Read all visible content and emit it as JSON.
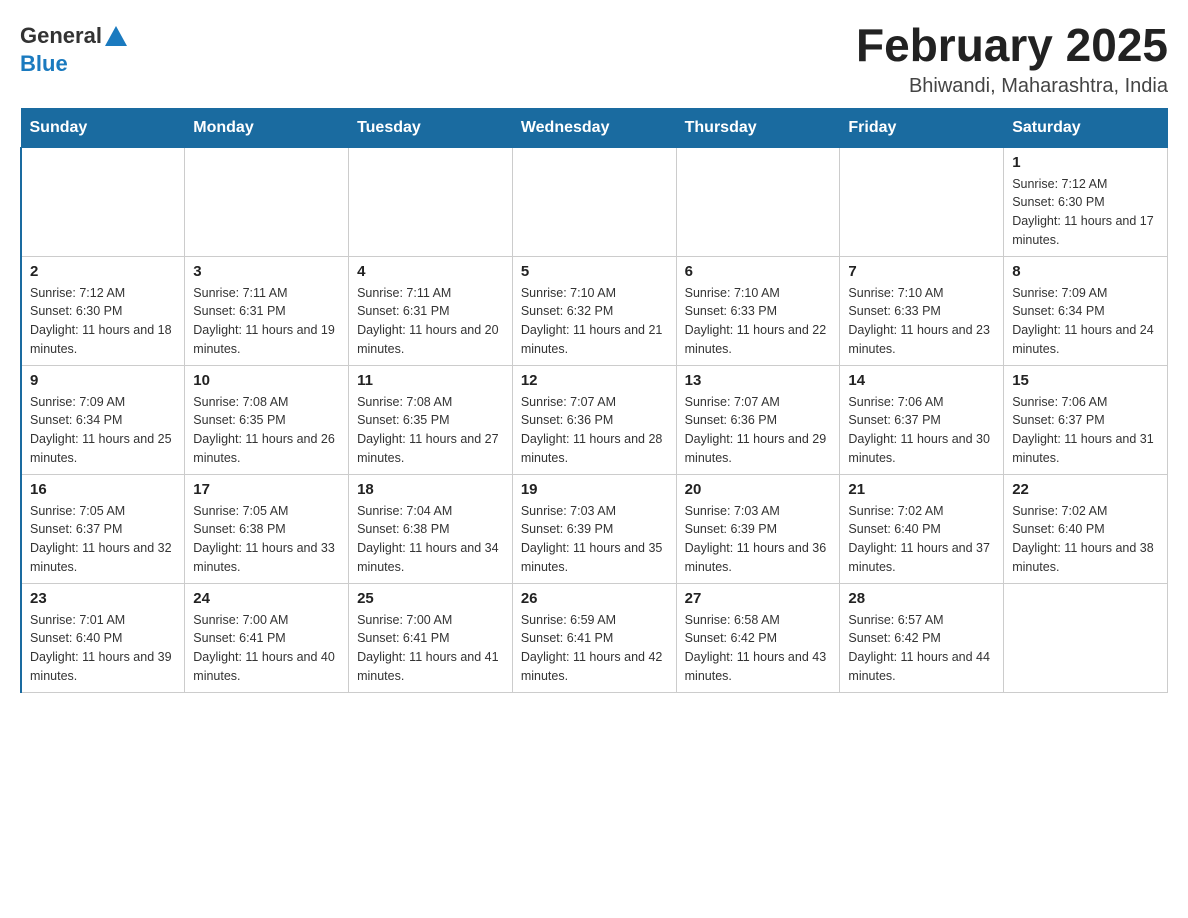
{
  "header": {
    "logo_general": "General",
    "logo_blue": "Blue",
    "title": "February 2025",
    "subtitle": "Bhiwandi, Maharashtra, India"
  },
  "weekdays": [
    "Sunday",
    "Monday",
    "Tuesday",
    "Wednesday",
    "Thursday",
    "Friday",
    "Saturday"
  ],
  "weeks": [
    [
      {
        "day": "",
        "info": ""
      },
      {
        "day": "",
        "info": ""
      },
      {
        "day": "",
        "info": ""
      },
      {
        "day": "",
        "info": ""
      },
      {
        "day": "",
        "info": ""
      },
      {
        "day": "",
        "info": ""
      },
      {
        "day": "1",
        "info": "Sunrise: 7:12 AM\nSunset: 6:30 PM\nDaylight: 11 hours and 17 minutes."
      }
    ],
    [
      {
        "day": "2",
        "info": "Sunrise: 7:12 AM\nSunset: 6:30 PM\nDaylight: 11 hours and 18 minutes."
      },
      {
        "day": "3",
        "info": "Sunrise: 7:11 AM\nSunset: 6:31 PM\nDaylight: 11 hours and 19 minutes."
      },
      {
        "day": "4",
        "info": "Sunrise: 7:11 AM\nSunset: 6:31 PM\nDaylight: 11 hours and 20 minutes."
      },
      {
        "day": "5",
        "info": "Sunrise: 7:10 AM\nSunset: 6:32 PM\nDaylight: 11 hours and 21 minutes."
      },
      {
        "day": "6",
        "info": "Sunrise: 7:10 AM\nSunset: 6:33 PM\nDaylight: 11 hours and 22 minutes."
      },
      {
        "day": "7",
        "info": "Sunrise: 7:10 AM\nSunset: 6:33 PM\nDaylight: 11 hours and 23 minutes."
      },
      {
        "day": "8",
        "info": "Sunrise: 7:09 AM\nSunset: 6:34 PM\nDaylight: 11 hours and 24 minutes."
      }
    ],
    [
      {
        "day": "9",
        "info": "Sunrise: 7:09 AM\nSunset: 6:34 PM\nDaylight: 11 hours and 25 minutes."
      },
      {
        "day": "10",
        "info": "Sunrise: 7:08 AM\nSunset: 6:35 PM\nDaylight: 11 hours and 26 minutes."
      },
      {
        "day": "11",
        "info": "Sunrise: 7:08 AM\nSunset: 6:35 PM\nDaylight: 11 hours and 27 minutes."
      },
      {
        "day": "12",
        "info": "Sunrise: 7:07 AM\nSunset: 6:36 PM\nDaylight: 11 hours and 28 minutes."
      },
      {
        "day": "13",
        "info": "Sunrise: 7:07 AM\nSunset: 6:36 PM\nDaylight: 11 hours and 29 minutes."
      },
      {
        "day": "14",
        "info": "Sunrise: 7:06 AM\nSunset: 6:37 PM\nDaylight: 11 hours and 30 minutes."
      },
      {
        "day": "15",
        "info": "Sunrise: 7:06 AM\nSunset: 6:37 PM\nDaylight: 11 hours and 31 minutes."
      }
    ],
    [
      {
        "day": "16",
        "info": "Sunrise: 7:05 AM\nSunset: 6:37 PM\nDaylight: 11 hours and 32 minutes."
      },
      {
        "day": "17",
        "info": "Sunrise: 7:05 AM\nSunset: 6:38 PM\nDaylight: 11 hours and 33 minutes."
      },
      {
        "day": "18",
        "info": "Sunrise: 7:04 AM\nSunset: 6:38 PM\nDaylight: 11 hours and 34 minutes."
      },
      {
        "day": "19",
        "info": "Sunrise: 7:03 AM\nSunset: 6:39 PM\nDaylight: 11 hours and 35 minutes."
      },
      {
        "day": "20",
        "info": "Sunrise: 7:03 AM\nSunset: 6:39 PM\nDaylight: 11 hours and 36 minutes."
      },
      {
        "day": "21",
        "info": "Sunrise: 7:02 AM\nSunset: 6:40 PM\nDaylight: 11 hours and 37 minutes."
      },
      {
        "day": "22",
        "info": "Sunrise: 7:02 AM\nSunset: 6:40 PM\nDaylight: 11 hours and 38 minutes."
      }
    ],
    [
      {
        "day": "23",
        "info": "Sunrise: 7:01 AM\nSunset: 6:40 PM\nDaylight: 11 hours and 39 minutes."
      },
      {
        "day": "24",
        "info": "Sunrise: 7:00 AM\nSunset: 6:41 PM\nDaylight: 11 hours and 40 minutes."
      },
      {
        "day": "25",
        "info": "Sunrise: 7:00 AM\nSunset: 6:41 PM\nDaylight: 11 hours and 41 minutes."
      },
      {
        "day": "26",
        "info": "Sunrise: 6:59 AM\nSunset: 6:41 PM\nDaylight: 11 hours and 42 minutes."
      },
      {
        "day": "27",
        "info": "Sunrise: 6:58 AM\nSunset: 6:42 PM\nDaylight: 11 hours and 43 minutes."
      },
      {
        "day": "28",
        "info": "Sunrise: 6:57 AM\nSunset: 6:42 PM\nDaylight: 11 hours and 44 minutes."
      },
      {
        "day": "",
        "info": ""
      }
    ]
  ]
}
